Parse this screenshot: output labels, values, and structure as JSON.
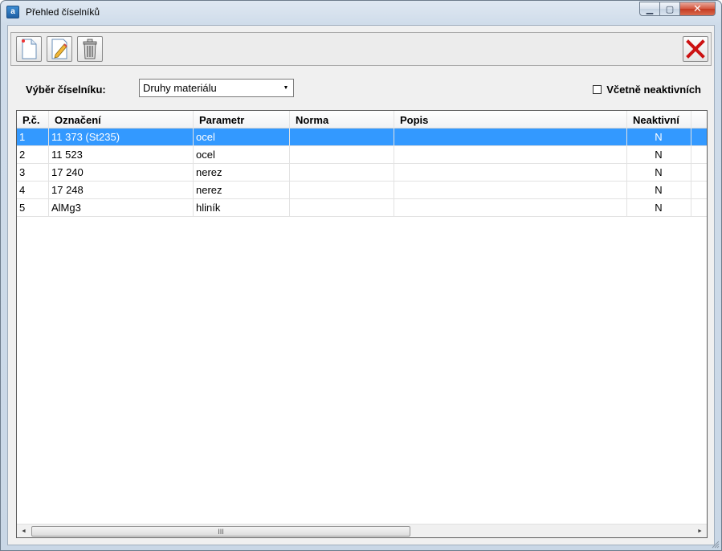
{
  "window": {
    "title": "Přehled číselníků",
    "icon": "app-icon",
    "caption": {
      "minimize": "▁",
      "maximize": "▢",
      "close": "✕"
    }
  },
  "toolbar": {
    "buttons": [
      {
        "name": "new-record-button",
        "icon": "new-document-icon"
      },
      {
        "name": "edit-record-button",
        "icon": "edit-pencil-icon"
      },
      {
        "name": "delete-record-button",
        "icon": "trash-icon"
      }
    ],
    "close_icon": "close-x-icon"
  },
  "filter": {
    "label": "Výběr číselníku:",
    "selected": "Druhy materiálu",
    "include_inactive_label": "Včetně neaktivních",
    "include_inactive_checked": false
  },
  "grid": {
    "columns": [
      "P.č.",
      "Označení",
      "Parametr",
      "Norma",
      "Popis",
      "Neaktivní",
      ""
    ],
    "rows": [
      [
        "1",
        "11 373 (St235)",
        "ocel",
        "",
        "",
        "N",
        ""
      ],
      [
        "2",
        "11 523",
        "ocel",
        "",
        "",
        "N",
        ""
      ],
      [
        "3",
        "17 240",
        "nerez",
        "",
        "",
        "N",
        ""
      ],
      [
        "4",
        "17 248",
        "nerez",
        "",
        "",
        "N",
        ""
      ],
      [
        "5",
        "AlMg3",
        "hliník",
        "",
        "",
        "N",
        ""
      ]
    ],
    "selected_row": 0,
    "scrollbar": {
      "left": "◄",
      "right": "►",
      "grip": "III"
    }
  },
  "colors": {
    "selection": "#3399ff",
    "close_red": "#cc1111"
  }
}
